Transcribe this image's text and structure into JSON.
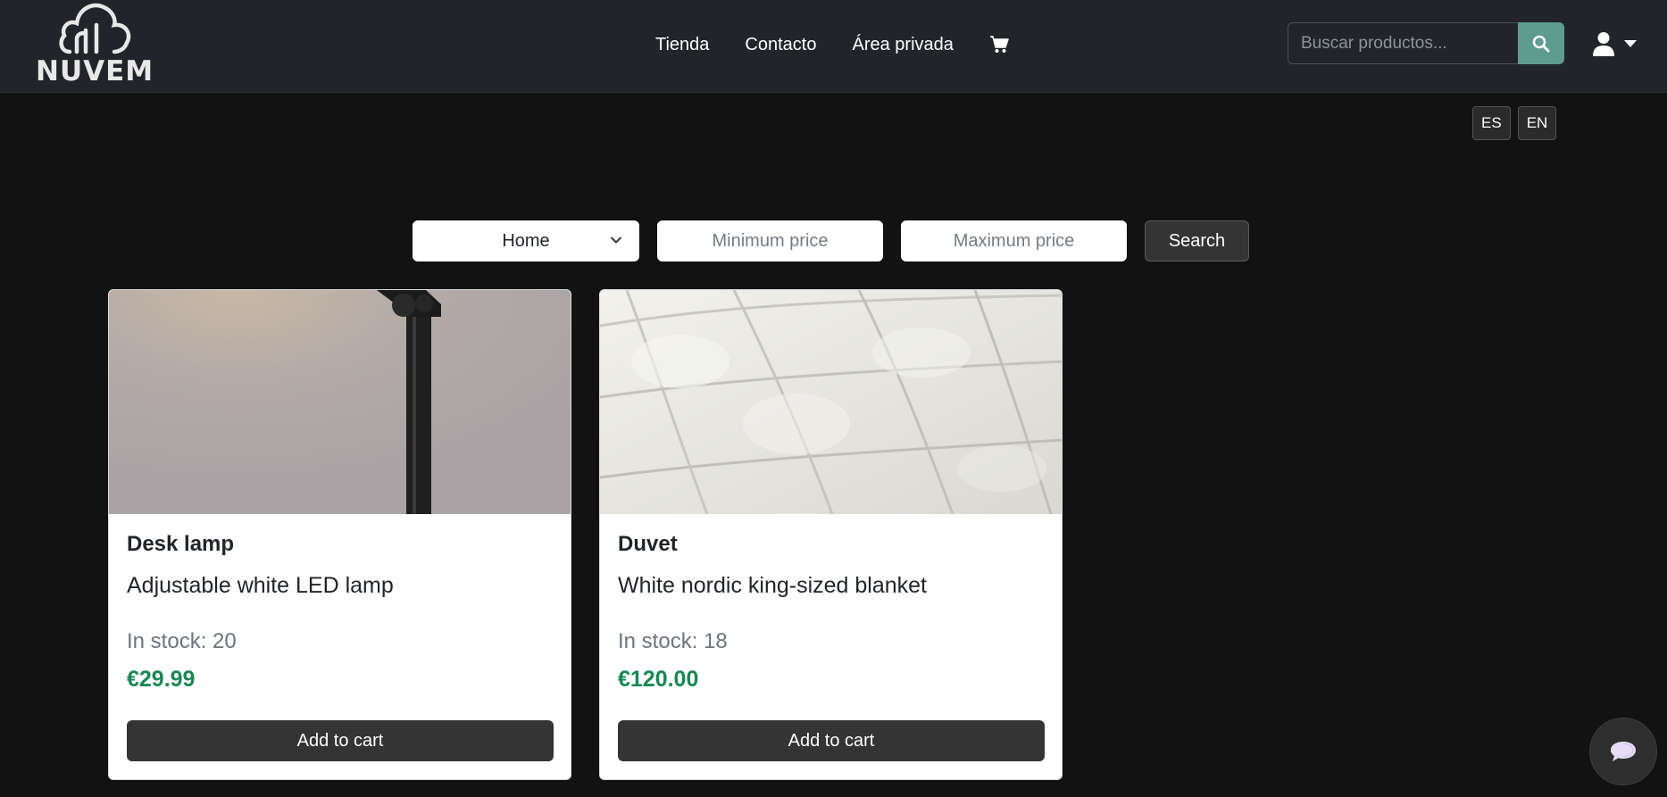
{
  "navbar": {
    "logo_text": "NUVEM",
    "links": [
      "Tienda",
      "Contacto",
      "Área privada"
    ],
    "search_placeholder": "Buscar productos..."
  },
  "language": {
    "es": "ES",
    "en": "EN"
  },
  "filters": {
    "category_selected": "Home",
    "min_price_placeholder": "Minimum price",
    "max_price_placeholder": "Maximum price",
    "search_label": "Search"
  },
  "products": [
    {
      "name": "Desk lamp",
      "description": "Adjustable white LED lamp",
      "stock": "In stock: 20",
      "price": "€29.99",
      "button": "Add to cart"
    },
    {
      "name": "Duvet",
      "description": "White nordic king-sized blanket",
      "stock": "In stock: 18",
      "price": "€120.00",
      "button": "Add to cart"
    }
  ],
  "colors": {
    "navbar_bg": "#212529",
    "page_bg": "#121212",
    "search_button": "#5f9c90",
    "price_green": "#198754",
    "button_dark": "#343434"
  },
  "icons": [
    "cloud-logo-icon",
    "cart-icon",
    "search-icon",
    "user-icon",
    "caret-down-icon",
    "chevron-down-icon",
    "chat-icon"
  ]
}
